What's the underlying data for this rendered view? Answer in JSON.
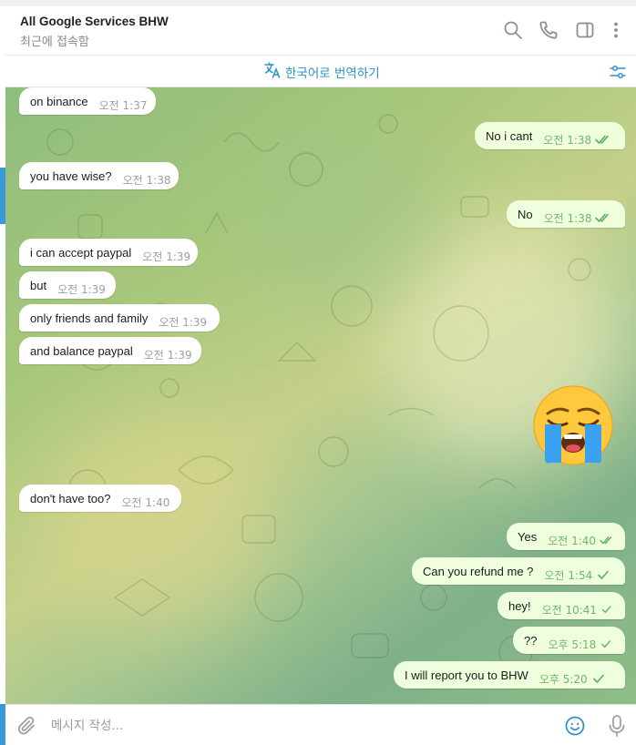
{
  "header": {
    "title": "All Google Services BHW",
    "status": "최근에 접속함",
    "icons": [
      "search-icon",
      "phone-icon",
      "sidebar-toggle-icon",
      "more-vertical-icon"
    ]
  },
  "translate_bar": {
    "label": "한국어로 번역하기",
    "icon": "translate-icon",
    "settings_icon": "translate-settings-icon"
  },
  "messages": [
    {
      "dir": "in",
      "text": "on binance",
      "time": "오전 1:37"
    },
    {
      "dir": "out",
      "text": "No i cant",
      "time": "오전 1:38",
      "status": "read"
    },
    {
      "dir": "in",
      "text": "you have wise?",
      "time": "오전 1:38"
    },
    {
      "dir": "out",
      "text": "No",
      "time": "오전 1:38",
      "status": "read"
    },
    {
      "dir": "in",
      "text": "i can accept paypal",
      "time": "오전 1:39"
    },
    {
      "dir": "in",
      "text": "but",
      "time": "오전 1:39"
    },
    {
      "dir": "in",
      "text": "only friends and family",
      "time": "오전 1:39"
    },
    {
      "dir": "in",
      "text": "and balance paypal",
      "time": "오전 1:39"
    },
    {
      "dir": "out",
      "sticker": "loudly-crying-face-sticker"
    },
    {
      "dir": "in",
      "text": "don't have too?",
      "time": "오전 1:40"
    },
    {
      "dir": "out",
      "text": "Yes",
      "time": "오전 1:40",
      "status": "read"
    },
    {
      "dir": "out",
      "text": "Can you refund me ?",
      "time": "오전 1:54",
      "status": "sent"
    },
    {
      "dir": "out",
      "text": "hey!",
      "time": "오전 10:41",
      "status": "sent"
    },
    {
      "dir": "out",
      "text": "??",
      "time": "오후 5:18",
      "status": "sent"
    },
    {
      "dir": "out",
      "text": "I will report you to BHW",
      "time": "오후 5:20",
      "status": "sent"
    }
  ],
  "composer": {
    "placeholder": "메시지 작성...",
    "value": "",
    "icons": [
      "paperclip-icon",
      "emoji-icon",
      "microphone-icon"
    ]
  },
  "colors": {
    "accent": "#2f8ecb",
    "incoming_bubble": "#ffffff",
    "outgoing_bubble": "#effedd",
    "outgoing_time": "#6fb86a",
    "side_accent": "#3a9ad9"
  }
}
